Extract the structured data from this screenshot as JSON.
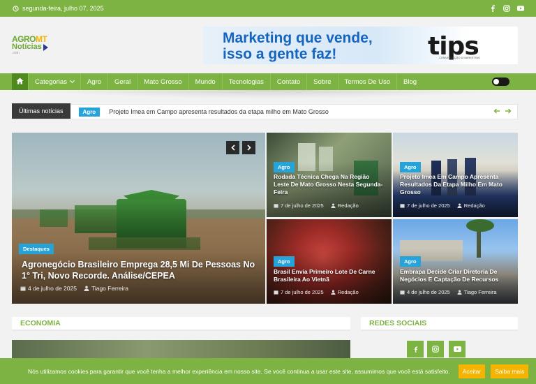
{
  "topbar": {
    "date": "segunda-feira, julho 07, 2025"
  },
  "logo": {
    "line1a": "AGRO",
    "line1b": "MT",
    "line2": "Notícias",
    "line3": ".com"
  },
  "banner": {
    "line1": "Marketing que vende,",
    "line2": "isso a gente faz!",
    "brand": "tips",
    "brand_sub": "COMUNICAÇÃO & MARKETING"
  },
  "nav": {
    "items": [
      "Categorias",
      "Agro",
      "Geral",
      "Mato Grosso",
      "Mundo",
      "Tecnologias",
      "Contato",
      "Sobre",
      "Termos De Uso",
      "Blog"
    ]
  },
  "ticker": {
    "label": "Últimas notícias",
    "badge": "Agro",
    "text": "Projeto Imea em Campo apresenta resultados da etapa milho em Mato Grosso"
  },
  "hero": {
    "category": "Destaques",
    "title": "Agronegócio Brasileiro Emprega 28,5 Mi De Pessoas No 1° Tri, Novo Recorde. Análise/CEPEA",
    "date": "4 de julho de 2025",
    "author": "Tiago Ferreira"
  },
  "cards": [
    {
      "category": "Agro",
      "title": "Rodada Técnica Chega Na Região Leste De Mato Grosso Nesta Segunda-Feira",
      "date": "7 de julho de 2025",
      "author": "Redação"
    },
    {
      "category": "Agro",
      "title": "Projeto Imea Em Campo Apresenta Resultados Da Etapa Milho Em Mato Grosso",
      "date": "7 de julho de 2025",
      "author": "Redação"
    },
    {
      "category": "Agro",
      "title": "Brasil Envia Primeiro Lote De Carne Brasileira Ao Vietnã",
      "date": "7 de julho de 2025",
      "author": "Redação"
    },
    {
      "category": "Agro",
      "title": "Embrapa Decide Criar Diretoria De Negócios E Captação De Recursos",
      "date": "4 de julho de 2025",
      "author": "Tiago Ferreira"
    }
  ],
  "sections": {
    "economia": "ECONOMIA",
    "redes": "REDES SOCIAIS"
  },
  "cookie": {
    "text": "Nós utilizamos cookies para garantir que você tenha a melhor experiência em nosso site. Se você continua a usar este site, assumimos que você está satisfeito.",
    "accept": "Aceitar",
    "more": "Saiba mais"
  },
  "colors": {
    "accent": "#7cb342",
    "badge": "#26a3d9",
    "button": "#f5b400"
  }
}
